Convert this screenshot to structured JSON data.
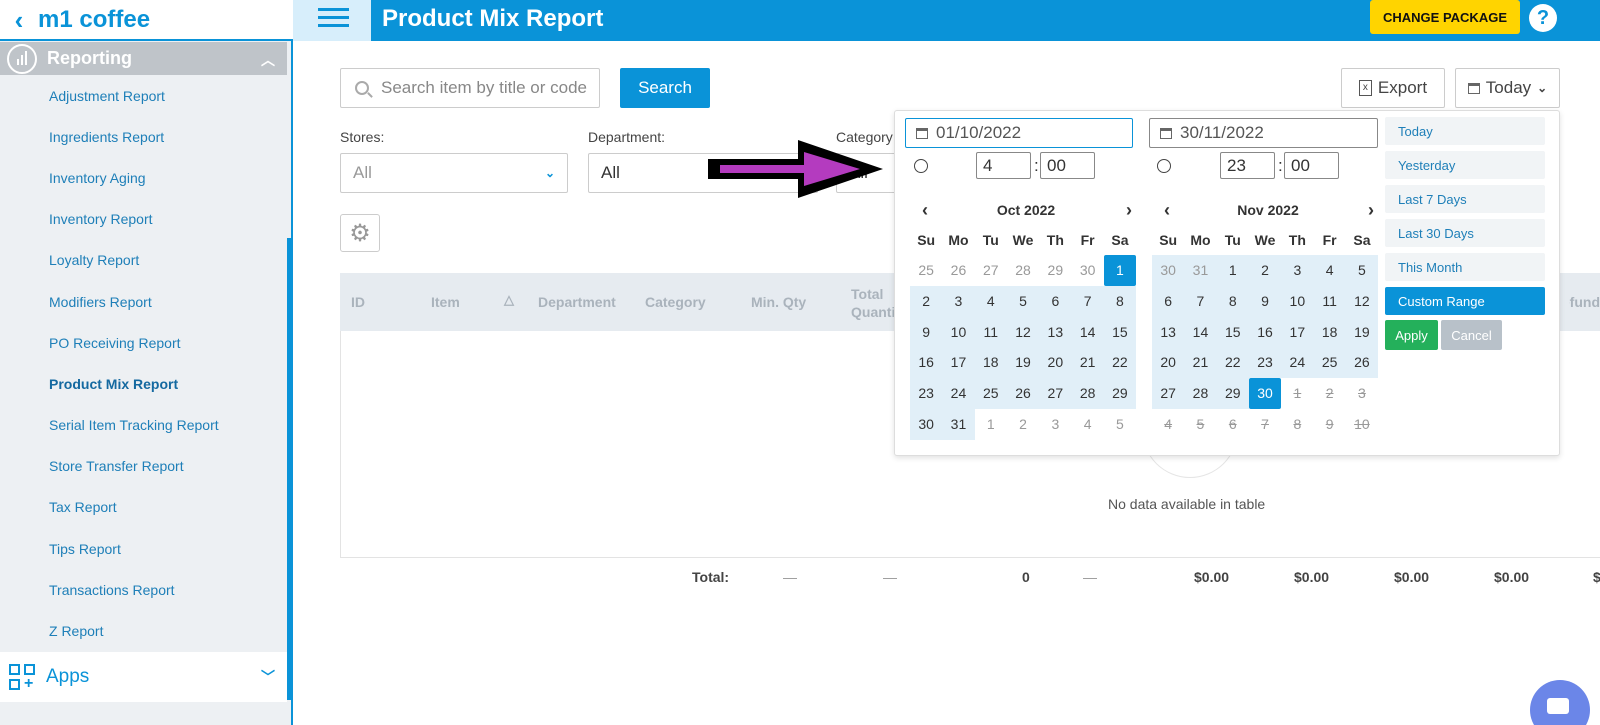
{
  "brand": {
    "back_icon": "chevron-left-icon",
    "name": "m1 coffee"
  },
  "sidebar": {
    "section": "Reporting",
    "items": [
      {
        "label": "Adjustment Report"
      },
      {
        "label": "Ingredients Report"
      },
      {
        "label": "Inventory Aging"
      },
      {
        "label": "Inventory Report"
      },
      {
        "label": "Loyalty Report"
      },
      {
        "label": "Modifiers Report"
      },
      {
        "label": "PO Receiving Report"
      },
      {
        "label": "Product Mix Report",
        "active": true
      },
      {
        "label": "Serial Item Tracking Report"
      },
      {
        "label": "Store Transfer Report"
      },
      {
        "label": "Tax Report"
      },
      {
        "label": "Tips Report"
      },
      {
        "label": "Transactions Report"
      },
      {
        "label": "Z Report"
      }
    ],
    "apps_label": "Apps"
  },
  "header": {
    "title": "Product Mix Report",
    "change_package": "CHANGE PACKAGE",
    "help": "?"
  },
  "toolbar": {
    "search_placeholder": "Search item by title or code",
    "search_button": "Search",
    "export_button": "Export",
    "range_button": "Today"
  },
  "filters": {
    "stores_label": "Stores:",
    "stores_value": "All",
    "department_label": "Department:",
    "department_value": "All",
    "category_label": "Category:",
    "category_value": "All"
  },
  "table": {
    "columns": [
      "ID",
      "Item",
      "Department",
      "Category",
      "Min. Qty",
      "Total Quantity",
      "Refund"
    ],
    "empty_text": "No data available in table",
    "total_label": "Total:",
    "totals": [
      "—",
      "—",
      "0",
      "—",
      "$0.00",
      "$0.00",
      "$0.00",
      "$0.00",
      "$"
    ]
  },
  "datepicker": {
    "start_date": "01/10/2022",
    "end_date": "30/11/2022",
    "start_hour": "4",
    "start_minute": "00",
    "end_hour": "23",
    "end_minute": "00",
    "weekdays": [
      "Su",
      "Mo",
      "Tu",
      "We",
      "Th",
      "Fr",
      "Sa"
    ],
    "left_month": "Oct 2022",
    "right_month": "Nov 2022",
    "ranges": [
      "Today",
      "Yesterday",
      "Last 7 Days",
      "Last 30 Days",
      "This Month",
      "Custom Range"
    ],
    "active_range": "Custom Range",
    "apply": "Apply",
    "cancel": "Cancel"
  },
  "colors": {
    "accent": "#0a93d8",
    "package_button": "#ffd400",
    "apply": "#24b05b",
    "annotation_arrow": "#b43bbf"
  }
}
